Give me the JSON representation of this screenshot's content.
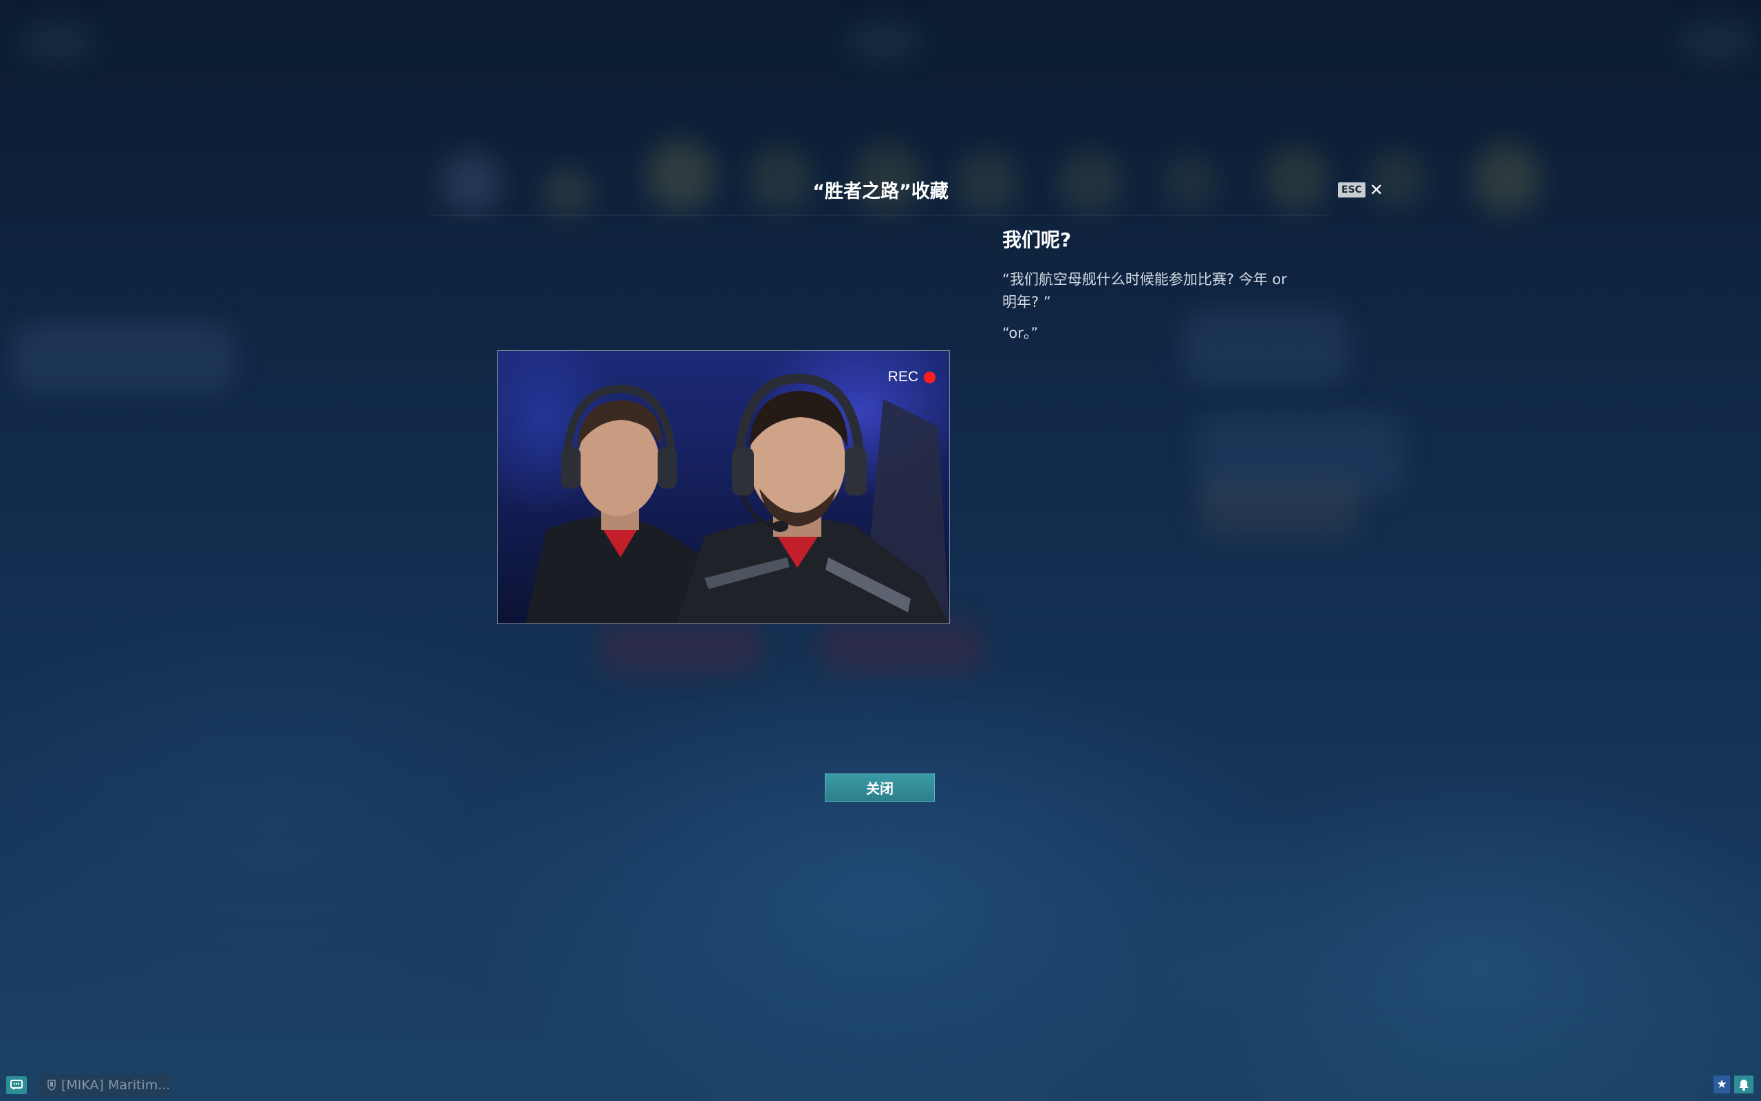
{
  "dialog": {
    "title": "“胜者之路”收藏",
    "esc_key": "ESC",
    "close_glyph": "✕",
    "close_button_label": "关闭"
  },
  "image": {
    "rec_label": "REC",
    "rec_color": "#ff1e1e"
  },
  "content": {
    "heading": "我们呢?",
    "quote": "“我们航空母舰什么时候能参加比赛? 今年 or 明年? ”",
    "answer": "“or。”"
  },
  "bottom_bar": {
    "chat_channel_label": "[MIKA] Maritim..."
  },
  "colors": {
    "accent_teal": "#2e8e98",
    "star_button_blue": "#2a5c9e"
  },
  "icons": {
    "esc_close": "close-icon",
    "chat": "chat-bubble-icon",
    "clan": "clan-shield-icon",
    "star": "star-icon",
    "bell": "bell-icon"
  }
}
